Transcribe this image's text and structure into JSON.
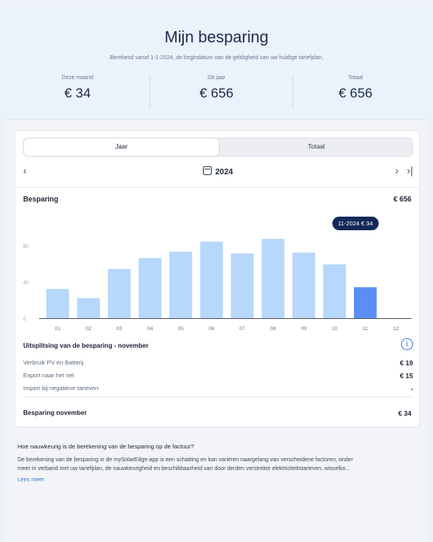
{
  "hero": {
    "title": "Mijn besparing",
    "subtitle": "Berekend vanaf 1-1-2024, de begindatum van de geldigheid van uw huidige tariefplan.",
    "stats": [
      {
        "label": "Deze maand",
        "value": "€ 34"
      },
      {
        "label": "Dit jaar",
        "value": "€ 656"
      },
      {
        "label": "Totaal",
        "value": "€ 656"
      }
    ]
  },
  "tabs": {
    "year": "Jaar",
    "total": "Totaal",
    "active": "year"
  },
  "nav": {
    "prev": "‹",
    "year": "2024",
    "next": "›",
    "last": "›|"
  },
  "savings": {
    "label": "Besparing",
    "value": "€ 656"
  },
  "tooltip": "11-2024 € 34",
  "chart_data": {
    "type": "bar",
    "categories": [
      "01",
      "02",
      "03",
      "04",
      "05",
      "06",
      "07",
      "08",
      "09",
      "10",
      "11",
      "12"
    ],
    "values": [
      32,
      22,
      54,
      66,
      73,
      84,
      71,
      87,
      72,
      59,
      34,
      null
    ],
    "highlighted": "11",
    "ylim": [
      0,
      100
    ],
    "yticks": [
      "0",
      "40",
      "80"
    ],
    "colors": {
      "bar": "#b7d7fb",
      "highlight": "#5b8ff3"
    }
  },
  "breakdown": {
    "title": "Uitsplitsing van de besparing - november",
    "rows": [
      {
        "label": "Verbruik PV en Batterij",
        "value": "€ 19"
      },
      {
        "label": "Export naar het net",
        "value": "€ 15"
      },
      {
        "label": "Import bij negatieve tarieven",
        "value": "-"
      }
    ],
    "total_label": "Besparing november",
    "total_value": "€ 34"
  },
  "faq": {
    "question": "Hoe nauwkeurig is de berekening van de besparing op de factuur?",
    "answer_line1": "De berekening van de besparing in de mySolarEdge-app is een schatting en kan variëren naargelang van verscheidene factoren, onder",
    "answer_line2": "meer in verband met uw tariefplan, de nauwkeurigheid en beschikbaarheid van door derden verstrekte elektriciteitstarieven, wisselko...",
    "more": "Lees meer"
  }
}
